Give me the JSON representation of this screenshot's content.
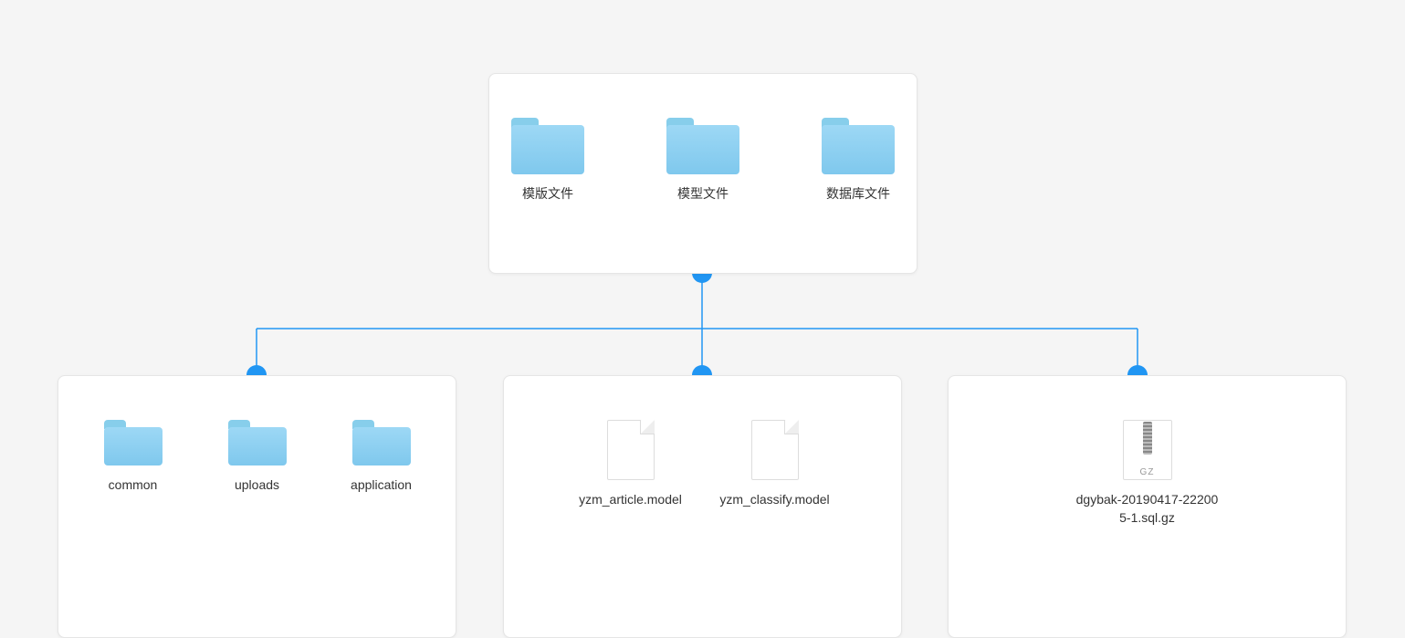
{
  "root": {
    "folders": [
      {
        "label": "模版文件"
      },
      {
        "label": "模型文件"
      },
      {
        "label": "数据库文件"
      }
    ]
  },
  "children": [
    {
      "folders": [
        {
          "label": "common"
        },
        {
          "label": "uploads"
        },
        {
          "label": "application"
        }
      ]
    },
    {
      "files": [
        {
          "label": "yzm_article.model"
        },
        {
          "label": "yzm_classify.model"
        }
      ]
    },
    {
      "gz_label_ext": "GZ",
      "files": [
        {
          "label": "dgybak-20190417-222005-1.sql.gz"
        }
      ]
    }
  ],
  "colors": {
    "accent": "#2196f3",
    "folder": "#87ceeb"
  }
}
